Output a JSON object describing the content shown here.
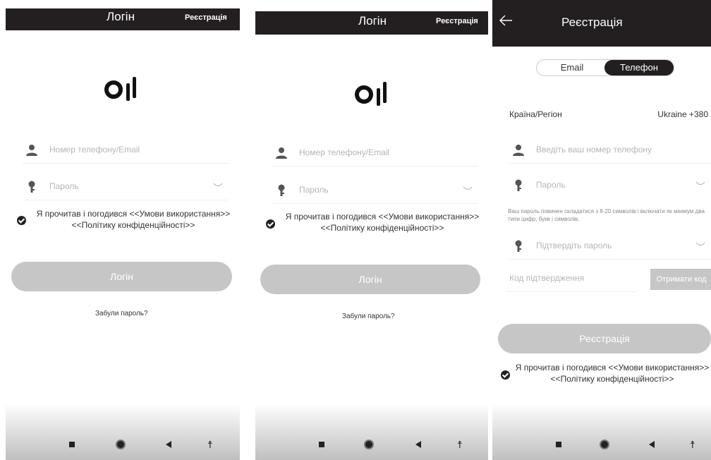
{
  "login": {
    "title": "Логін",
    "register_link": "Реєстрація",
    "phone_placeholder": "Номер телефону/Email",
    "password_placeholder": "Пароль",
    "agree_line1": "Я прочитав і погодився <<Умови використання>>",
    "agree_line2": "<<Політику конфіденційності>>",
    "login_button": "Логін",
    "forgot_password": "Забули пароль?"
  },
  "register": {
    "title": "Реєстрація",
    "tab_email": "Email",
    "tab_phone": "Телефон",
    "country_label": "Країна/Регіон",
    "country_value": "Ukraine +380",
    "phone_placeholder": "Введіть ваш номер телефону",
    "password_placeholder": "Пароль",
    "password_hint": "Ваш пароль повинен складатися з 8-20 символів і включати як мінімум два типи цифр, букв і символів.",
    "confirm_placeholder": "Підтвердіть пароль",
    "code_placeholder": "Код підтвердження",
    "get_code_button": "Отримати код",
    "register_button": "Реєстрація",
    "agree_line1": "Я прочитав і погодився <<Умови використання>>",
    "agree_line2": "<<Політику конфіденційності>>"
  },
  "colors": {
    "topbar": "#231f20",
    "button_disabled": "#c6c6c6"
  },
  "icons": {
    "user": "user-icon",
    "key": "key-icon",
    "eye": "eye-closed-icon",
    "check": "check-circle-icon",
    "back": "back-arrow-icon"
  }
}
